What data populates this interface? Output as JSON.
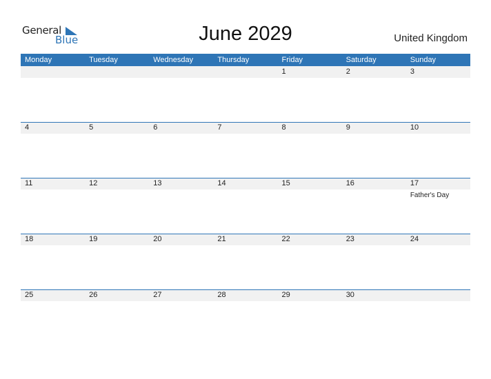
{
  "logo": {
    "line1": "General",
    "line2": "Blue"
  },
  "title": "June 2029",
  "country": "United Kingdom",
  "colors": {
    "accent": "#2e75b6",
    "band": "#f1f1f1"
  },
  "weekdays": [
    "Monday",
    "Tuesday",
    "Wednesday",
    "Thursday",
    "Friday",
    "Saturday",
    "Sunday"
  ],
  "weeks": [
    [
      {
        "day": ""
      },
      {
        "day": ""
      },
      {
        "day": ""
      },
      {
        "day": ""
      },
      {
        "day": "1"
      },
      {
        "day": "2"
      },
      {
        "day": "3"
      }
    ],
    [
      {
        "day": "4"
      },
      {
        "day": "5"
      },
      {
        "day": "6"
      },
      {
        "day": "7"
      },
      {
        "day": "8"
      },
      {
        "day": "9"
      },
      {
        "day": "10"
      }
    ],
    [
      {
        "day": "11"
      },
      {
        "day": "12"
      },
      {
        "day": "13"
      },
      {
        "day": "14"
      },
      {
        "day": "15"
      },
      {
        "day": "16"
      },
      {
        "day": "17",
        "event": "Father's Day"
      }
    ],
    [
      {
        "day": "18"
      },
      {
        "day": "19"
      },
      {
        "day": "20"
      },
      {
        "day": "21"
      },
      {
        "day": "22"
      },
      {
        "day": "23"
      },
      {
        "day": "24"
      }
    ],
    [
      {
        "day": "25"
      },
      {
        "day": "26"
      },
      {
        "day": "27"
      },
      {
        "day": "28"
      },
      {
        "day": "29"
      },
      {
        "day": "30"
      },
      {
        "day": ""
      }
    ]
  ]
}
